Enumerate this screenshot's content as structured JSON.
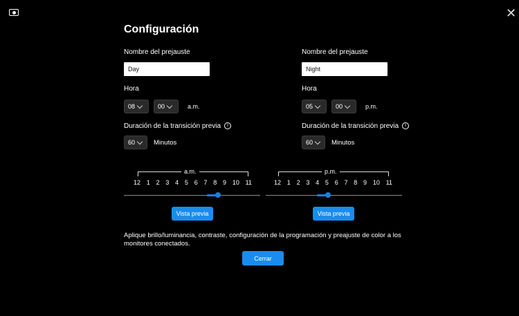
{
  "window": {
    "title": "Configuración",
    "close_glyph": "✕"
  },
  "left": {
    "preset_label": "Nombre del prejauste",
    "preset_value": "Day",
    "hour_label": "Hora",
    "hour": "08",
    "minute": "00",
    "period": "a.m.",
    "transition_label": "Duración de la transición previa",
    "transition_value": "60",
    "transition_unit": "Minutos",
    "timeline_label": "a.m.",
    "ticks": [
      "12",
      "1",
      "2",
      "3",
      "4",
      "5",
      "6",
      "7",
      "8",
      "9",
      "10",
      "11"
    ],
    "slider_value_hour": 8,
    "preview_label": "Vista previa"
  },
  "right": {
    "preset_label": "Nombre del prejauste",
    "preset_value": "Night",
    "hour_label": "Hora",
    "hour": "05",
    "minute": "00",
    "period": "p.m.",
    "transition_label": "Duración de la transición previa",
    "transition_value": "60",
    "transition_unit": "Minutos",
    "timeline_label": "p.m.",
    "ticks": [
      "12",
      "1",
      "2",
      "3",
      "4",
      "5",
      "6",
      "7",
      "8",
      "9",
      "10",
      "11"
    ],
    "slider_value_hour": 5,
    "preview_label": "Vista previa"
  },
  "note": "Aplique brillo/luminancia, contraste, configuración de la programación y preajuste de color a los monitores conectados.",
  "close_button": "Cerrar",
  "info_glyph": "i",
  "colors": {
    "accent": "#1a8cf0",
    "background": "#000000"
  }
}
